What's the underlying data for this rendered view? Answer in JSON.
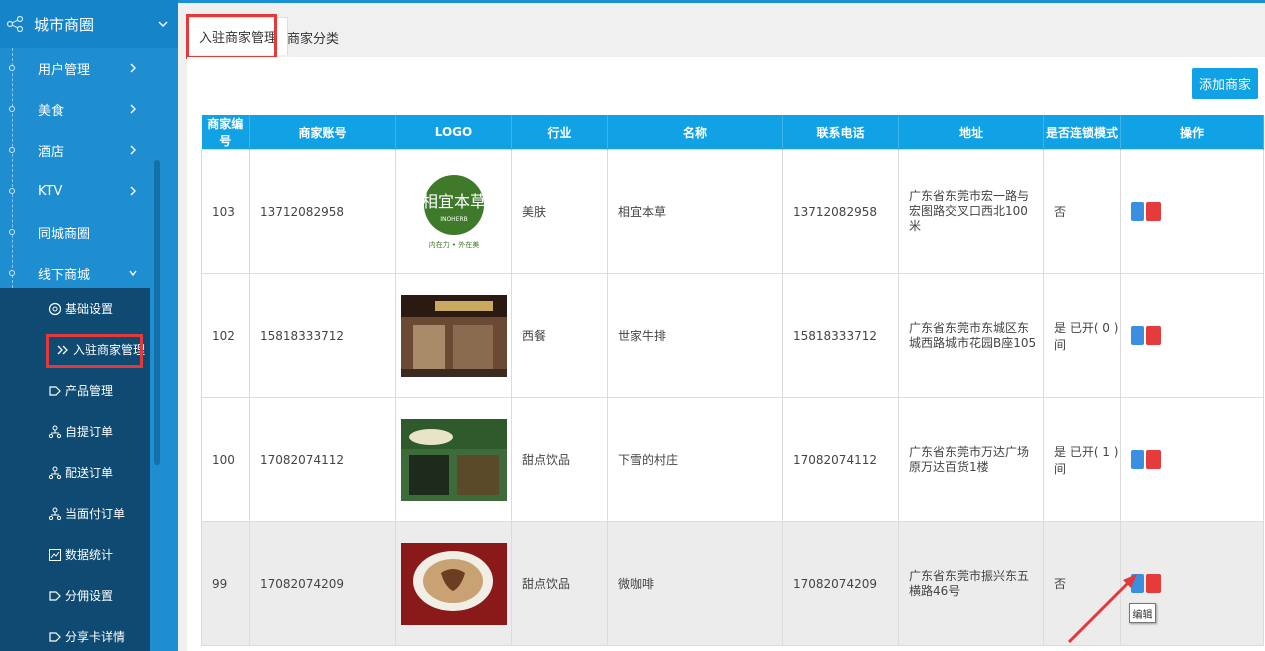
{
  "sidebar": {
    "title": "城市商圈",
    "items": [
      {
        "label": "用户管理",
        "has_arrow": true
      },
      {
        "label": "美食",
        "has_arrow": true
      },
      {
        "label": "酒店",
        "has_arrow": true
      },
      {
        "label": "KTV",
        "has_arrow": true
      },
      {
        "label": "同城商圈",
        "has_arrow": false
      },
      {
        "label": "线下商城",
        "has_arrow": true
      }
    ],
    "submenu": [
      {
        "label": "基础设置",
        "icon": "gear-icon"
      },
      {
        "label": "入驻商家管理",
        "icon": "double-chevron-icon",
        "active": true
      },
      {
        "label": "产品管理",
        "icon": "tag-icon"
      },
      {
        "label": "自提订单",
        "icon": "org-icon"
      },
      {
        "label": "配送订单",
        "icon": "org-icon"
      },
      {
        "label": "当面付订单",
        "icon": "org-icon"
      },
      {
        "label": "数据统计",
        "icon": "chart-icon"
      },
      {
        "label": "分佣设置",
        "icon": "tag-icon"
      },
      {
        "label": "分享卡详情",
        "icon": "tag-icon"
      }
    ]
  },
  "tabs": [
    {
      "label": "入驻商家管理",
      "active": true
    },
    {
      "label": "商家分类",
      "active": false
    }
  ],
  "toolbar": {
    "add_label": "添加商家"
  },
  "table": {
    "headers": [
      "商家编号",
      "商家账号",
      "LOGO",
      "行业",
      "名称",
      "联系电话",
      "地址",
      "是否连锁模式",
      "操作"
    ],
    "rows": [
      {
        "id": "103",
        "account": "13712082958",
        "industry": "美肤",
        "name": "相宜本草",
        "phone": "13712082958",
        "address": "广东省东莞市宏一路与宏图路交叉口西北100米",
        "chain": "否",
        "logo_text": "相宜本草",
        "logo_sub": "INOHERB",
        "logo_tag": "内在力 • 外在美"
      },
      {
        "id": "102",
        "account": "15818333712",
        "industry": "西餐",
        "name": "世家牛排",
        "phone": "15818333712",
        "address": "广东省东莞市东城区东城西路城市花园B座105",
        "chain": "是 已开( 0 )间"
      },
      {
        "id": "100",
        "account": "17082074112",
        "industry": "甜点饮品",
        "name": "下雪的村庄",
        "phone": "17082074112",
        "address": "广东省东莞市万达广场原万达百货1楼",
        "chain": "是 已开( 1 )间"
      },
      {
        "id": "99",
        "account": "17082074209",
        "industry": "甜点饮品",
        "name": "微咖啡",
        "phone": "17082074209",
        "address": "广东省东莞市振兴东五横路46号",
        "chain": "否"
      }
    ]
  },
  "tooltip": "编辑",
  "colors": {
    "accent": "#10a2e4",
    "sidebar": "#1f8ed1",
    "submenu": "#0e4a72",
    "highlight": "#e23a3a"
  }
}
